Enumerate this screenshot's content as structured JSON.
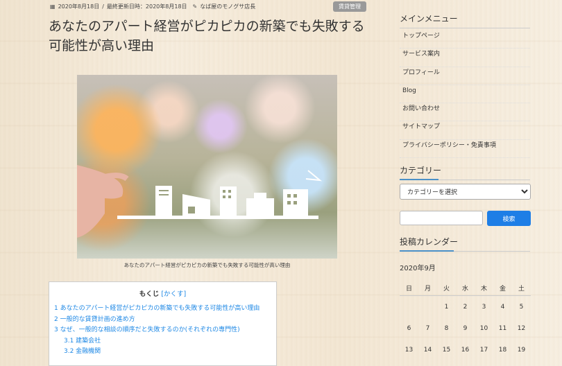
{
  "post": {
    "date_icon": "calendar-icon",
    "published": "2020年8月18日",
    "separator": "/",
    "updated_label": "最終更新日時：",
    "updated": "2020年8月18日",
    "author_icon": "pencil-icon",
    "author": "なば屋のモノグサ店長",
    "category_badge": "賃貸管理",
    "title": "あなたのアパート経営がピカピカの新築でも失敗する可能性が高い理由",
    "image_caption": "あなたのアパート経営がピカピカの新築でも失敗する可能性が高い理由"
  },
  "toc": {
    "title": "もくじ",
    "toggle": "[かくす]",
    "items": [
      {
        "label": "1 あなたのアパート経営がピカピカの新築でも失敗する可能性が高い理由"
      },
      {
        "label": "2 一般的な賃貸計画の進め方"
      },
      {
        "label": "3 なぜ、一般的な相談の順序だと失敗するのか(それぞれの専門性)"
      },
      {
        "label": "3.1 建築会社"
      },
      {
        "label": "3.2 金融機関"
      }
    ]
  },
  "sidebar": {
    "menu_title": "メインメニュー",
    "menu_items": [
      {
        "label": "トップページ"
      },
      {
        "label": "サービス案内"
      },
      {
        "label": "プロフィール"
      },
      {
        "label": "Blog"
      },
      {
        "label": "お問い合わせ"
      },
      {
        "label": "サイトマップ"
      },
      {
        "label": "プライバシーポリシー・免責事項"
      }
    ],
    "category_title": "カテゴリー",
    "category_select": "カテゴリーを選択",
    "search_button": "検索",
    "calendar_title": "投稿カレンダー",
    "calendar_month": "2020年9月",
    "weekdays": [
      "日",
      "月",
      "火",
      "水",
      "木",
      "金",
      "土"
    ],
    "weeks": [
      [
        "",
        "",
        "1",
        "2",
        "3",
        "4",
        "5"
      ],
      [
        "6",
        "7",
        "8",
        "9",
        "10",
        "11",
        "12"
      ],
      [
        "13",
        "14",
        "15",
        "16",
        "17",
        "18",
        "19"
      ]
    ]
  },
  "colors": {
    "accent": "#1e7ee6",
    "link": "#1e88e5",
    "badge": "#999999"
  }
}
